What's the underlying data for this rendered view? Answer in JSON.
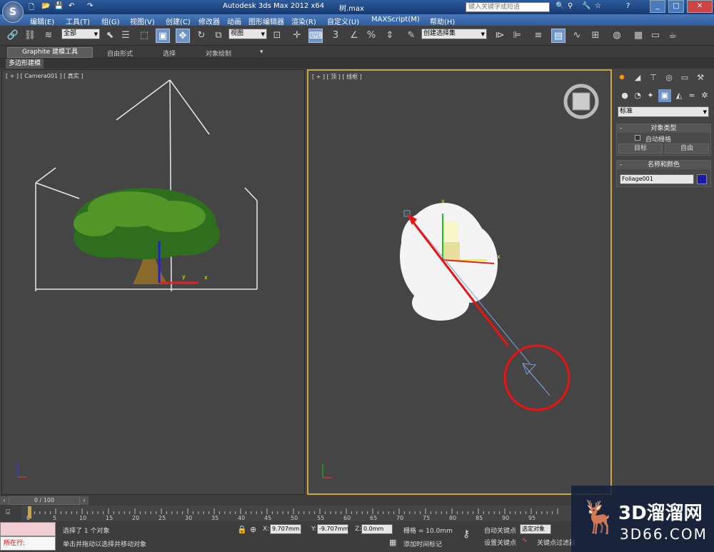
{
  "app": {
    "title": "Autodesk 3ds Max  2012 x64",
    "file": "树.max",
    "search_placeholder": "键入关键字或短语"
  },
  "menu": [
    "编辑(E)",
    "工具(T)",
    "组(G)",
    "视图(V)",
    "创建(C)",
    "修改器",
    "动画",
    "图形编辑器",
    "渲染(R)",
    "自定义(U)",
    "MAXScript(M)",
    "帮助(H)"
  ],
  "toolbar": {
    "selection_filter": "全部",
    "reference_coord": "视图",
    "named_selection": "创建选择集"
  },
  "ribbon": {
    "tabs": [
      "Graphite 建模工具",
      "自由形式",
      "选择",
      "对象绘制"
    ],
    "sub_label": "多边形建模"
  },
  "viewports": {
    "left_label": "[ + ] [ Camera001 ] [ 真实 ]",
    "right_label": "[ + ] [ 顶 ] [ 线框 ]"
  },
  "command_panel": {
    "category": "标准",
    "object_type": {
      "title": "对象类型",
      "autogrid": "自动栅格",
      "buttons": [
        "目标",
        "自由"
      ]
    },
    "name_color": {
      "title": "名称和颜色",
      "name": "Foliage001",
      "color": "#1a1aa8"
    }
  },
  "timeline": {
    "frame_label": "0 / 100",
    "ticks": [
      0,
      5,
      10,
      15,
      20,
      25,
      30,
      35,
      40,
      45,
      50,
      55,
      60,
      65,
      70,
      75,
      80,
      85,
      90,
      95
    ]
  },
  "status": {
    "selection": "选择了 1 个对象",
    "prompt": "单击并拖动以选择并移动对象",
    "running": "所在行:",
    "x": "9.707mm",
    "y": "-9.707mm",
    "z": "0.0mm",
    "grid": "栅格 = 10.0mm",
    "add_time_tag": "添加时间标记",
    "autokey": "自动关键点",
    "setkey": "设置关键点",
    "selected": "选定对象",
    "key_filter": "关键点过滤器"
  },
  "watermark": {
    "brand": "3D溜溜网",
    "url": "3D66.COM"
  }
}
